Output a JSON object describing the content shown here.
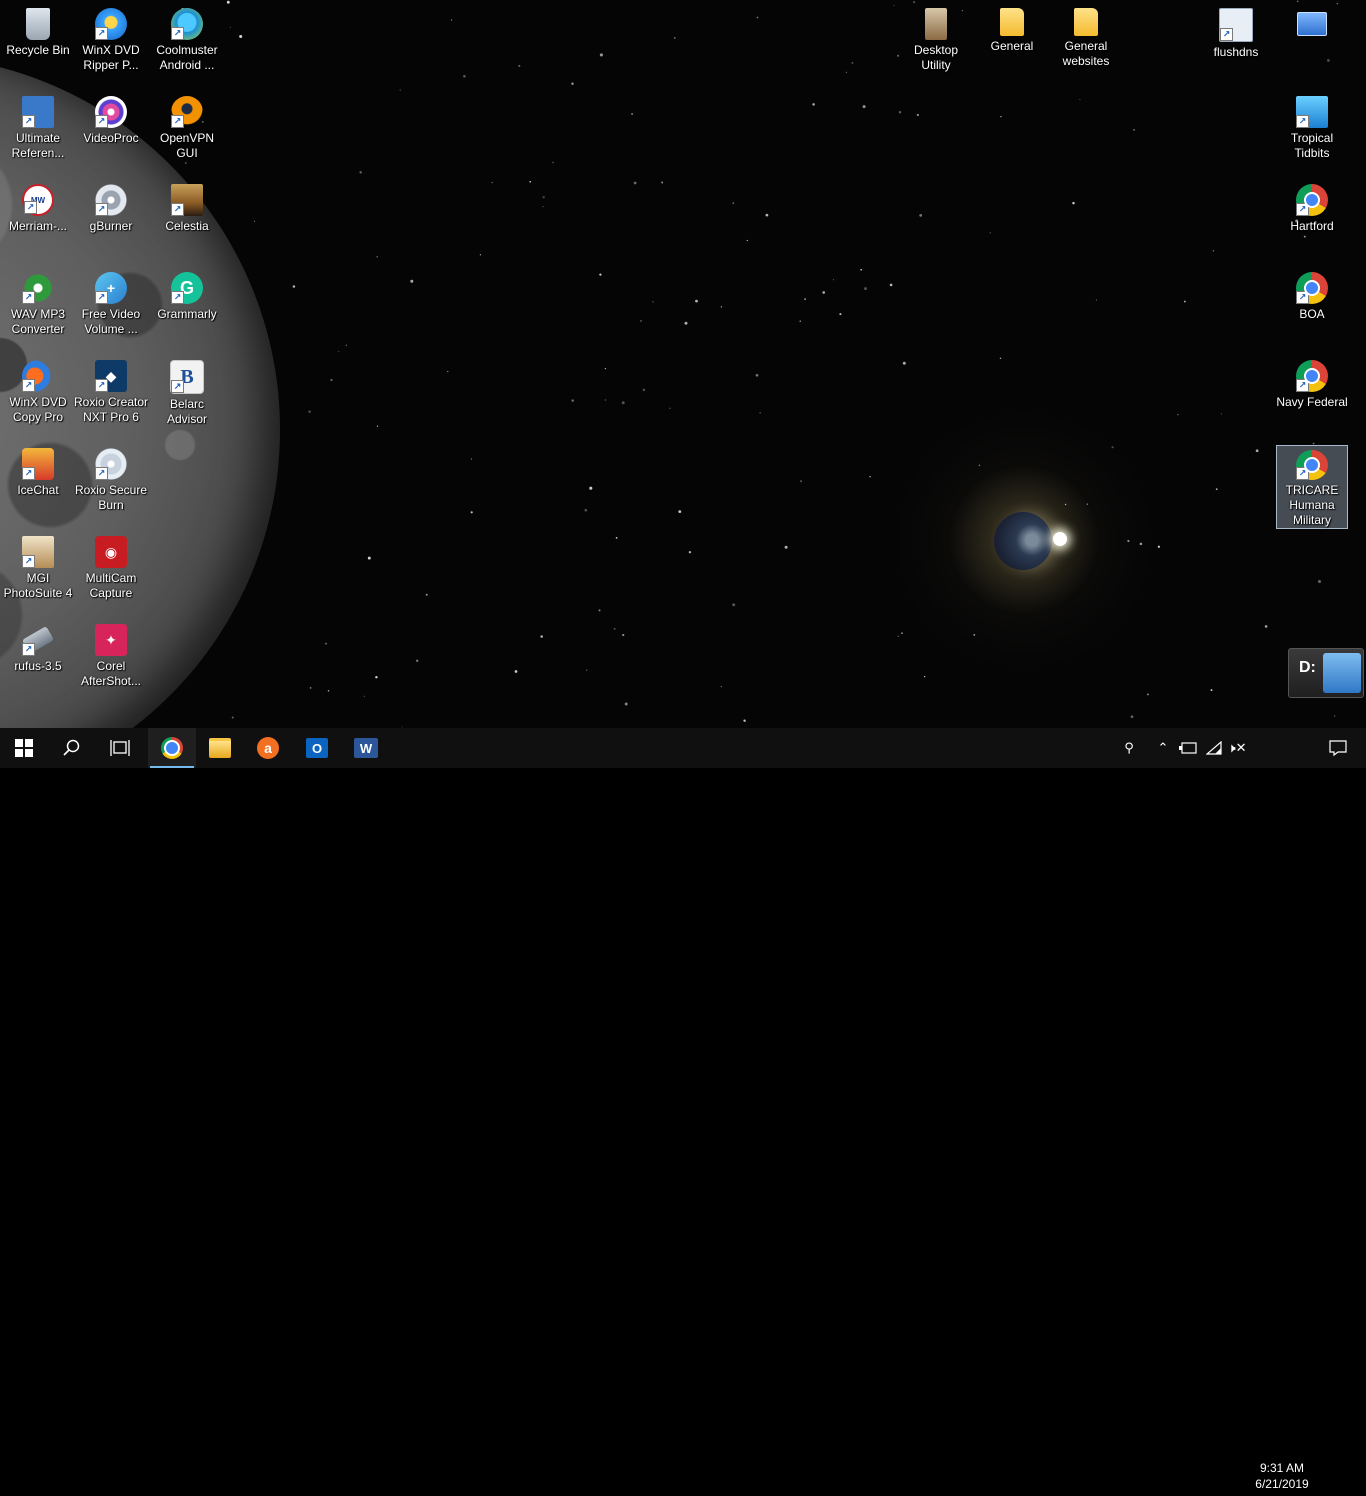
{
  "desktop": {
    "icons": [
      {
        "label": "Recycle Bin",
        "icon": "recycle-bin-icon"
      },
      {
        "label": "WinX DVD Ripper P...",
        "icon": "winx-dvd-icon"
      },
      {
        "label": "Coolmuster Android ...",
        "icon": "coolmuster-icon"
      },
      {
        "label": "Ultimate Referen...",
        "icon": "ultimate-reference-icon"
      },
      {
        "label": "VideoProc",
        "icon": "videoproc-icon"
      },
      {
        "label": "OpenVPN GUI",
        "icon": "openvpn-icon"
      },
      {
        "label": "Merriam-...",
        "icon": "merriam-webster-icon"
      },
      {
        "label": "gBurner",
        "icon": "gburner-icon"
      },
      {
        "label": "Celestia",
        "icon": "celestia-icon"
      },
      {
        "label": "WAV MP3 Converter",
        "icon": "wav-mp3-converter-icon"
      },
      {
        "label": "Free Video Volume ...",
        "icon": "free-video-volume-icon"
      },
      {
        "label": "Grammarly",
        "icon": "grammarly-icon"
      },
      {
        "label": "WinX DVD Copy Pro",
        "icon": "winx-dvd-copy-icon"
      },
      {
        "label": "Roxio Creator NXT Pro 6",
        "icon": "roxio-creator-icon"
      },
      {
        "label": "Belarc Advisor",
        "icon": "belarc-icon"
      },
      {
        "label": "IceChat",
        "icon": "icechat-icon"
      },
      {
        "label": "Roxio Secure Burn",
        "icon": "roxio-secure-burn-icon"
      },
      {
        "label": "MGI PhotoSuite 4",
        "icon": "mgi-photosuite-icon"
      },
      {
        "label": "MultiCam Capture",
        "icon": "multicam-icon"
      },
      {
        "label": "rufus-3.5",
        "icon": "rufus-icon"
      },
      {
        "label": "Corel AfterShot...",
        "icon": "corel-aftershot-icon"
      },
      {
        "label": "Desktop Utility",
        "icon": "desktop-utility-icon"
      },
      {
        "label": "General",
        "icon": "folder-icon"
      },
      {
        "label": "General websites",
        "icon": "folder-icon"
      },
      {
        "label": "flushdns",
        "icon": "flushdns-icon"
      },
      {
        "label": "",
        "icon": "window-shortcut-icon"
      },
      {
        "label": "Tropical Tidbits",
        "icon": "tropical-tidbits-icon"
      },
      {
        "label": "Hartford",
        "icon": "chrome-icon"
      },
      {
        "label": "BOA",
        "icon": "chrome-icon"
      },
      {
        "label": "Navy Federal",
        "icon": "chrome-icon"
      },
      {
        "label": "TRICARE Humana Military",
        "icon": "chrome-icon"
      }
    ],
    "selected_icon": "TRICARE Humana Military",
    "drive_widget": {
      "letter": "D:",
      "icon": "usb-drive-icon"
    }
  },
  "taskbar": {
    "apps": [
      {
        "name": "start",
        "icon": "windows-icon"
      },
      {
        "name": "search",
        "icon": "search-icon"
      },
      {
        "name": "task-view",
        "icon": "task-view-icon"
      },
      {
        "name": "chrome",
        "icon": "chrome-icon",
        "active": true
      },
      {
        "name": "file-explorer",
        "icon": "folder-icon"
      },
      {
        "name": "avast",
        "icon": "avast-icon"
      },
      {
        "name": "outlook",
        "icon": "outlook-icon"
      },
      {
        "name": "word",
        "icon": "word-icon"
      }
    ],
    "tray": {
      "icons": [
        "people-icon",
        "chevron-up-icon",
        "battery-icon",
        "wifi-icon",
        "volume-muted-icon"
      ],
      "time": "9:31 AM",
      "date": "6/21/2019",
      "notification_icon": "action-center-icon"
    }
  },
  "colors": {
    "taskbar": "#101010",
    "accent": "#76b9ed",
    "selection": "#8fb4d6"
  }
}
